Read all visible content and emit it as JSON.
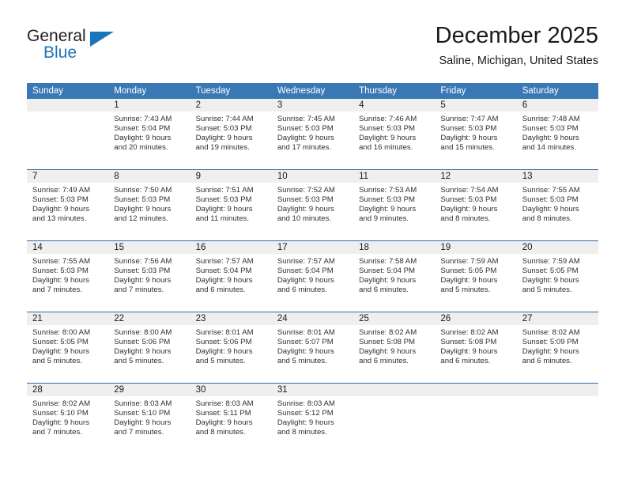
{
  "brand": {
    "name_part1": "General",
    "name_part2": "Blue",
    "logo_icon": "blue-triangle-icon",
    "accent_color": "#1b75bb"
  },
  "header": {
    "month_title": "December 2025",
    "location": "Saline, Michigan, United States"
  },
  "calendar": {
    "header_bg": "#3a78b5",
    "row_divider_color": "#2b6cb0",
    "daynum_band_color": "#efefef",
    "weekday_headers": [
      "Sunday",
      "Monday",
      "Tuesday",
      "Wednesday",
      "Thursday",
      "Friday",
      "Saturday"
    ],
    "weeks": [
      [
        {
          "day": ""
        },
        {
          "day": "1",
          "sunrise": "Sunrise: 7:43 AM",
          "sunset": "Sunset: 5:04 PM",
          "daylight_line1": "Daylight: 9 hours",
          "daylight_line2": "and 20 minutes."
        },
        {
          "day": "2",
          "sunrise": "Sunrise: 7:44 AM",
          "sunset": "Sunset: 5:03 PM",
          "daylight_line1": "Daylight: 9 hours",
          "daylight_line2": "and 19 minutes."
        },
        {
          "day": "3",
          "sunrise": "Sunrise: 7:45 AM",
          "sunset": "Sunset: 5:03 PM",
          "daylight_line1": "Daylight: 9 hours",
          "daylight_line2": "and 17 minutes."
        },
        {
          "day": "4",
          "sunrise": "Sunrise: 7:46 AM",
          "sunset": "Sunset: 5:03 PM",
          "daylight_line1": "Daylight: 9 hours",
          "daylight_line2": "and 16 minutes."
        },
        {
          "day": "5",
          "sunrise": "Sunrise: 7:47 AM",
          "sunset": "Sunset: 5:03 PM",
          "daylight_line1": "Daylight: 9 hours",
          "daylight_line2": "and 15 minutes."
        },
        {
          "day": "6",
          "sunrise": "Sunrise: 7:48 AM",
          "sunset": "Sunset: 5:03 PM",
          "daylight_line1": "Daylight: 9 hours",
          "daylight_line2": "and 14 minutes."
        }
      ],
      [
        {
          "day": "7",
          "sunrise": "Sunrise: 7:49 AM",
          "sunset": "Sunset: 5:03 PM",
          "daylight_line1": "Daylight: 9 hours",
          "daylight_line2": "and 13 minutes."
        },
        {
          "day": "8",
          "sunrise": "Sunrise: 7:50 AM",
          "sunset": "Sunset: 5:03 PM",
          "daylight_line1": "Daylight: 9 hours",
          "daylight_line2": "and 12 minutes."
        },
        {
          "day": "9",
          "sunrise": "Sunrise: 7:51 AM",
          "sunset": "Sunset: 5:03 PM",
          "daylight_line1": "Daylight: 9 hours",
          "daylight_line2": "and 11 minutes."
        },
        {
          "day": "10",
          "sunrise": "Sunrise: 7:52 AM",
          "sunset": "Sunset: 5:03 PM",
          "daylight_line1": "Daylight: 9 hours",
          "daylight_line2": "and 10 minutes."
        },
        {
          "day": "11",
          "sunrise": "Sunrise: 7:53 AM",
          "sunset": "Sunset: 5:03 PM",
          "daylight_line1": "Daylight: 9 hours",
          "daylight_line2": "and 9 minutes."
        },
        {
          "day": "12",
          "sunrise": "Sunrise: 7:54 AM",
          "sunset": "Sunset: 5:03 PM",
          "daylight_line1": "Daylight: 9 hours",
          "daylight_line2": "and 8 minutes."
        },
        {
          "day": "13",
          "sunrise": "Sunrise: 7:55 AM",
          "sunset": "Sunset: 5:03 PM",
          "daylight_line1": "Daylight: 9 hours",
          "daylight_line2": "and 8 minutes."
        }
      ],
      [
        {
          "day": "14",
          "sunrise": "Sunrise: 7:55 AM",
          "sunset": "Sunset: 5:03 PM",
          "daylight_line1": "Daylight: 9 hours",
          "daylight_line2": "and 7 minutes."
        },
        {
          "day": "15",
          "sunrise": "Sunrise: 7:56 AM",
          "sunset": "Sunset: 5:03 PM",
          "daylight_line1": "Daylight: 9 hours",
          "daylight_line2": "and 7 minutes."
        },
        {
          "day": "16",
          "sunrise": "Sunrise: 7:57 AM",
          "sunset": "Sunset: 5:04 PM",
          "daylight_line1": "Daylight: 9 hours",
          "daylight_line2": "and 6 minutes."
        },
        {
          "day": "17",
          "sunrise": "Sunrise: 7:57 AM",
          "sunset": "Sunset: 5:04 PM",
          "daylight_line1": "Daylight: 9 hours",
          "daylight_line2": "and 6 minutes."
        },
        {
          "day": "18",
          "sunrise": "Sunrise: 7:58 AM",
          "sunset": "Sunset: 5:04 PM",
          "daylight_line1": "Daylight: 9 hours",
          "daylight_line2": "and 6 minutes."
        },
        {
          "day": "19",
          "sunrise": "Sunrise: 7:59 AM",
          "sunset": "Sunset: 5:05 PM",
          "daylight_line1": "Daylight: 9 hours",
          "daylight_line2": "and 5 minutes."
        },
        {
          "day": "20",
          "sunrise": "Sunrise: 7:59 AM",
          "sunset": "Sunset: 5:05 PM",
          "daylight_line1": "Daylight: 9 hours",
          "daylight_line2": "and 5 minutes."
        }
      ],
      [
        {
          "day": "21",
          "sunrise": "Sunrise: 8:00 AM",
          "sunset": "Sunset: 5:05 PM",
          "daylight_line1": "Daylight: 9 hours",
          "daylight_line2": "and 5 minutes."
        },
        {
          "day": "22",
          "sunrise": "Sunrise: 8:00 AM",
          "sunset": "Sunset: 5:06 PM",
          "daylight_line1": "Daylight: 9 hours",
          "daylight_line2": "and 5 minutes."
        },
        {
          "day": "23",
          "sunrise": "Sunrise: 8:01 AM",
          "sunset": "Sunset: 5:06 PM",
          "daylight_line1": "Daylight: 9 hours",
          "daylight_line2": "and 5 minutes."
        },
        {
          "day": "24",
          "sunrise": "Sunrise: 8:01 AM",
          "sunset": "Sunset: 5:07 PM",
          "daylight_line1": "Daylight: 9 hours",
          "daylight_line2": "and 5 minutes."
        },
        {
          "day": "25",
          "sunrise": "Sunrise: 8:02 AM",
          "sunset": "Sunset: 5:08 PM",
          "daylight_line1": "Daylight: 9 hours",
          "daylight_line2": "and 6 minutes."
        },
        {
          "day": "26",
          "sunrise": "Sunrise: 8:02 AM",
          "sunset": "Sunset: 5:08 PM",
          "daylight_line1": "Daylight: 9 hours",
          "daylight_line2": "and 6 minutes."
        },
        {
          "day": "27",
          "sunrise": "Sunrise: 8:02 AM",
          "sunset": "Sunset: 5:09 PM",
          "daylight_line1": "Daylight: 9 hours",
          "daylight_line2": "and 6 minutes."
        }
      ],
      [
        {
          "day": "28",
          "sunrise": "Sunrise: 8:02 AM",
          "sunset": "Sunset: 5:10 PM",
          "daylight_line1": "Daylight: 9 hours",
          "daylight_line2": "and 7 minutes."
        },
        {
          "day": "29",
          "sunrise": "Sunrise: 8:03 AM",
          "sunset": "Sunset: 5:10 PM",
          "daylight_line1": "Daylight: 9 hours",
          "daylight_line2": "and 7 minutes."
        },
        {
          "day": "30",
          "sunrise": "Sunrise: 8:03 AM",
          "sunset": "Sunset: 5:11 PM",
          "daylight_line1": "Daylight: 9 hours",
          "daylight_line2": "and 8 minutes."
        },
        {
          "day": "31",
          "sunrise": "Sunrise: 8:03 AM",
          "sunset": "Sunset: 5:12 PM",
          "daylight_line1": "Daylight: 9 hours",
          "daylight_line2": "and 8 minutes."
        },
        {
          "day": ""
        },
        {
          "day": ""
        },
        {
          "day": ""
        }
      ]
    ]
  }
}
